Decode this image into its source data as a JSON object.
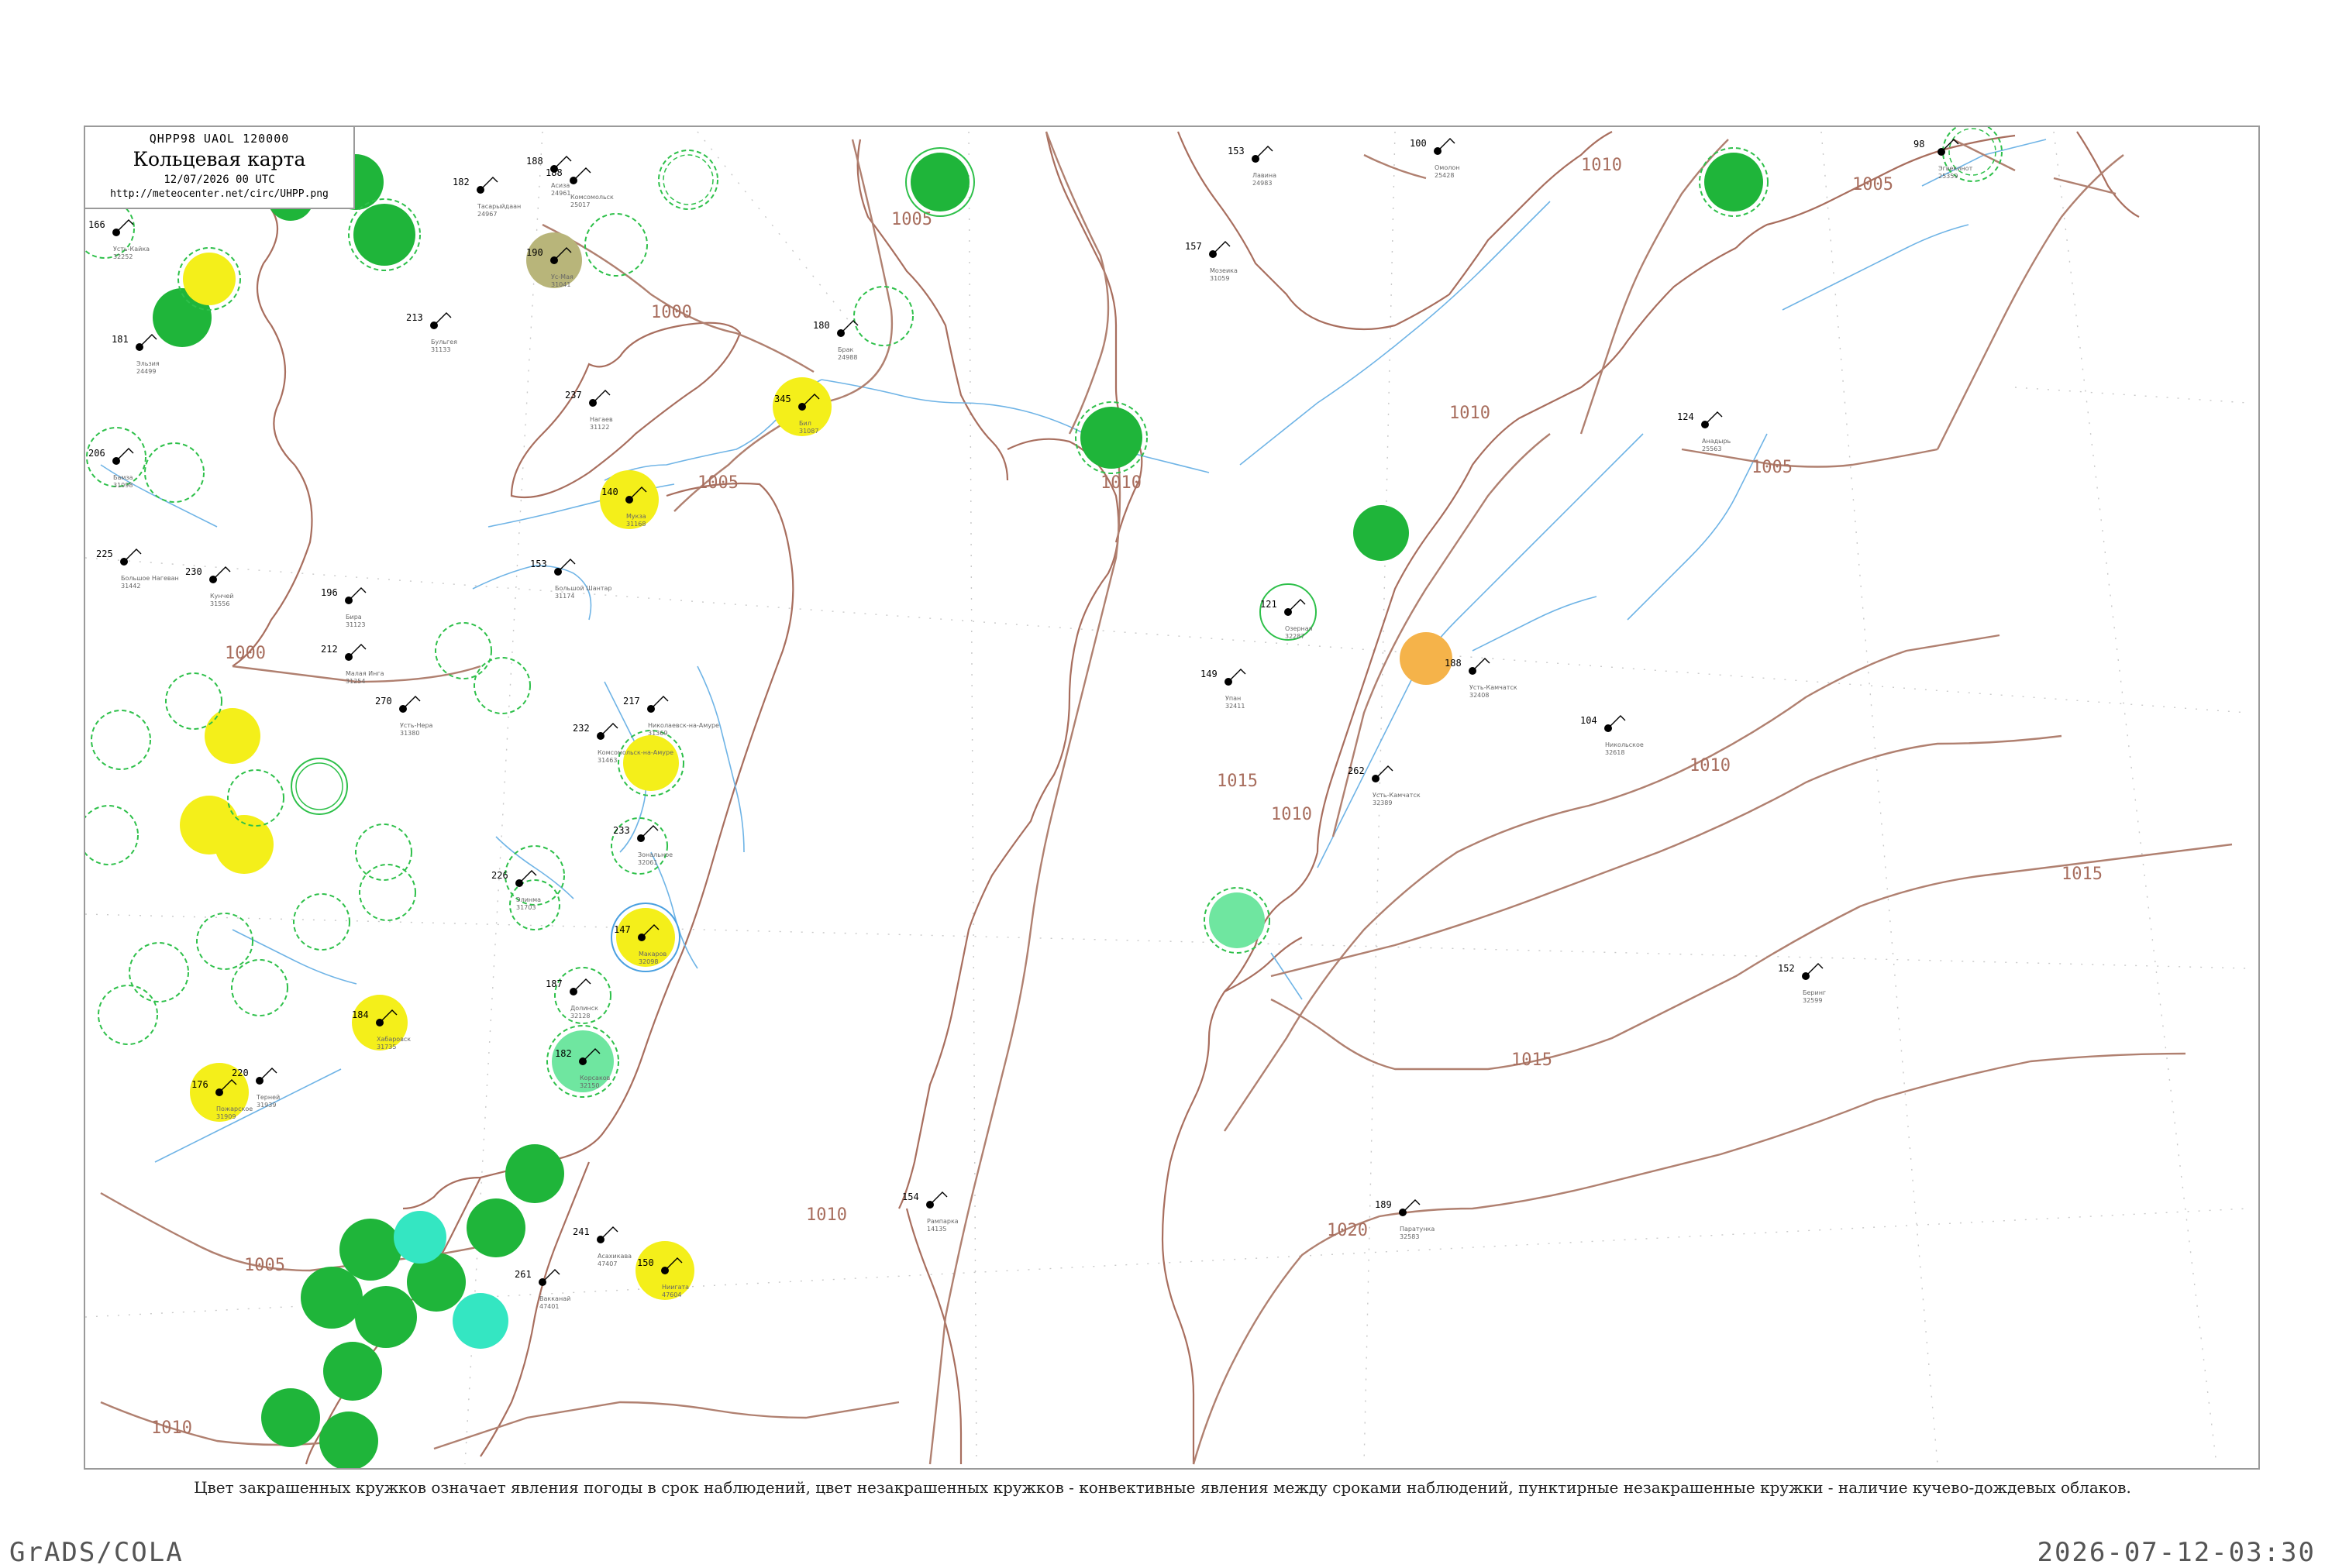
{
  "header": {
    "code": "QHPP98  UAOL  120000",
    "title": "Кольцевая карта",
    "datetime": "12/07/2026 00 UTC",
    "url": "http://meteocenter.net/circ/UHPP.png"
  },
  "caption": "Цвет закрашенных кружков означает явления погоды в срок наблюдений, цвет незакрашенных кружков - конвективные явления между сроками наблюдений, пунктирные незакрашенные кружки - наличие кучево-дождевых облаков.",
  "footer": {
    "left": "GrADS/COLA",
    "right": "2026-07-12-03:30"
  },
  "colors": {
    "green": "#1fb53a",
    "yellow": "#f4ef1a",
    "orange": "#f5b34a",
    "olive": "#b8b57a",
    "aqua": "#34e6c2",
    "mint": "#6fe6a0",
    "isobar": "#b08070",
    "river": "#6fb4e6"
  },
  "isobar_labels": [
    "1005",
    "1000",
    "1010",
    "1005",
    "1010",
    "1005",
    "1000",
    "1010",
    "1005",
    "1010",
    "1010",
    "1015",
    "1015",
    "1015",
    "1020",
    "1010",
    "1005",
    "1010"
  ],
  "stations": [
    {
      "code": "166",
      "name": "Усть-Кайка",
      "id": "32252"
    },
    {
      "code": "182",
      "name": "Тасарыйдаан",
      "id": "24967"
    },
    {
      "code": "188",
      "name": "Асиза",
      "id": "24961"
    },
    {
      "code": "188",
      "name": "Комсомольск",
      "id": "25017"
    },
    {
      "code": "190",
      "name": "Ус-Мая",
      "id": "31041"
    },
    {
      "code": "213",
      "name": "Бульгея",
      "id": "31133"
    },
    {
      "code": "181",
      "name": "Эльзия",
      "id": "24499"
    },
    {
      "code": "206",
      "name": "Бамза",
      "id": "31098"
    },
    {
      "code": "237",
      "name": "Нагаев",
      "id": "31122"
    },
    {
      "code": "180",
      "name": "Брак",
      "id": "24988"
    },
    {
      "code": "345",
      "name": "Бил",
      "id": "31087"
    },
    {
      "code": "140",
      "name": "Мукза",
      "id": "31168"
    },
    {
      "code": "153",
      "name": "Лавина",
      "id": "24983"
    },
    {
      "code": "157",
      "name": "Мозеика",
      "id": "31059"
    },
    {
      "code": "121",
      "name": "Озерная",
      "id": "32287"
    },
    {
      "code": "149",
      "name": "Упан",
      "id": "32411"
    },
    {
      "code": "225",
      "name": "Большое Нагеван",
      "id": "31442"
    },
    {
      "code": "230",
      "name": "Кунчей",
      "id": "31556"
    },
    {
      "code": "196",
      "name": "Бира",
      "id": "31123"
    },
    {
      "code": "153",
      "name": "Большой Шантар",
      "id": "31174"
    },
    {
      "code": "212",
      "name": "Малая Инга",
      "id": "31254"
    },
    {
      "code": "270",
      "name": "Усть-Нера",
      "id": "31380"
    },
    {
      "code": "226",
      "name": "Элинма",
      "id": "31703"
    },
    {
      "code": "217",
      "name": "Николаевск-на-Амуре",
      "id": "31369"
    },
    {
      "code": "232",
      "name": "Комсомольск-на-Амуре",
      "id": "31463"
    },
    {
      "code": "233",
      "name": "Зональное",
      "id": "32061"
    },
    {
      "code": "187",
      "name": "Долинск",
      "id": "32128"
    },
    {
      "code": "182",
      "name": "Корсаков",
      "id": "32150"
    },
    {
      "code": "147",
      "name": "Макаров",
      "id": "32098"
    },
    {
      "code": "184",
      "name": "Хабаровск",
      "id": "31735"
    },
    {
      "code": "176",
      "name": "Пожарское",
      "id": "31909"
    },
    {
      "code": "220",
      "name": "Терней",
      "id": "31939"
    },
    {
      "code": "154",
      "name": "Рампарка",
      "id": "14135"
    },
    {
      "code": "262",
      "name": "Усть-Камчатск",
      "id": "32389"
    },
    {
      "code": "188",
      "name": "Усть-Камчатск",
      "id": "32408"
    },
    {
      "code": "104",
      "name": "Никольское",
      "id": "32618"
    },
    {
      "code": "152",
      "name": "Беринг",
      "id": "32599"
    },
    {
      "code": "189",
      "name": "Паратунка",
      "id": "32583"
    },
    {
      "code": "124",
      "name": "Анадырь",
      "id": "25563"
    },
    {
      "code": "100",
      "name": "Омолон",
      "id": "25428"
    },
    {
      "code": "98",
      "name": "Эгвекинот",
      "id": "25359"
    },
    {
      "code": "150",
      "name": "Ниигата",
      "id": "47604"
    },
    {
      "code": "241",
      "name": "Асахикава",
      "id": "47407"
    },
    {
      "code": "261",
      "name": "Вакканай",
      "id": "47401"
    }
  ]
}
